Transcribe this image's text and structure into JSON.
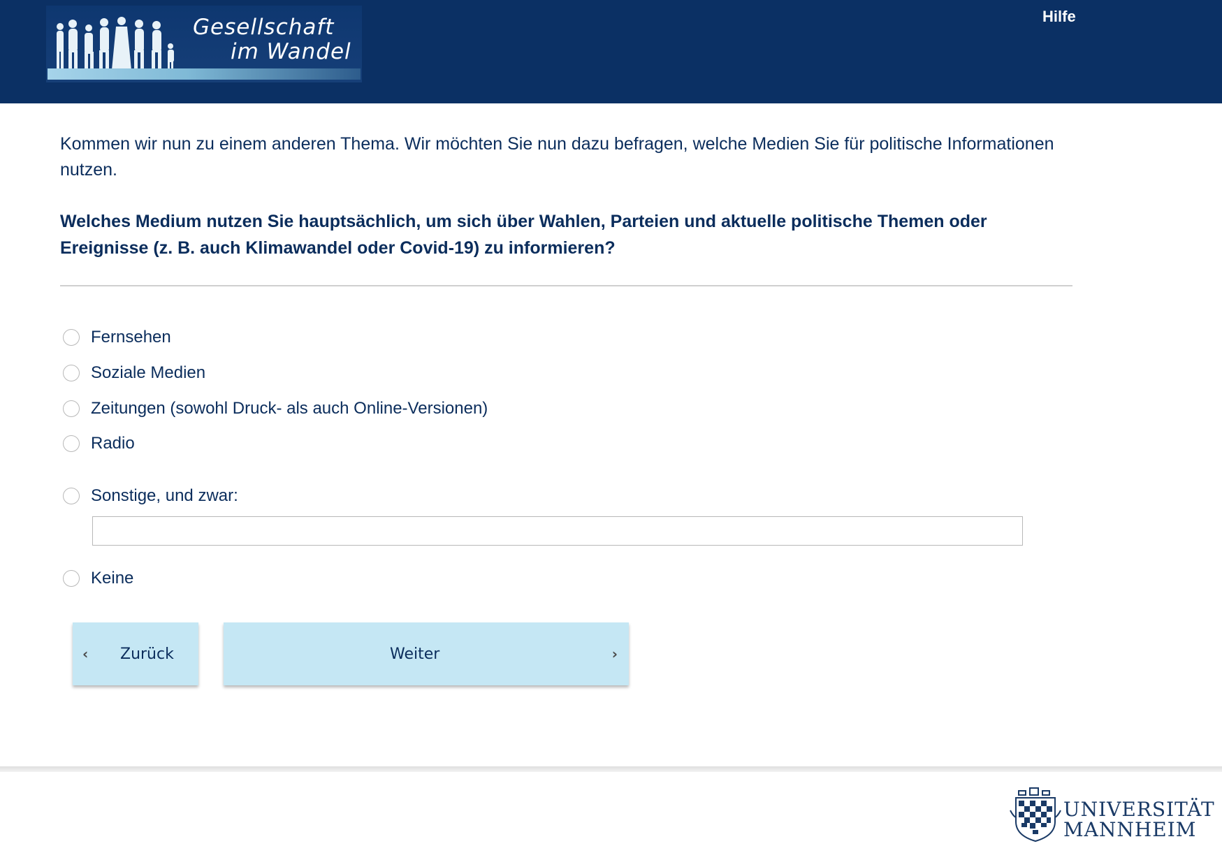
{
  "header": {
    "logo_line1": "Gesellschaft",
    "logo_line2": "im Wandel",
    "help_label": "Hilfe",
    "background_color": "#0b3064"
  },
  "intro_text": "Kommen wir nun zu einem anderen Thema. Wir möchten Sie nun dazu befragen, welche Medien Sie für politische Informationen nutzen.",
  "question_text": "Welches Medium nutzen Sie hauptsächlich, um sich über Wahlen, Parteien und aktuelle politische Themen oder Ereignisse (z. B. auch Klimawandel oder Covid-19) zu informieren?",
  "options": [
    {
      "label": "Fernsehen",
      "selected": false
    },
    {
      "label": "Soziale Medien",
      "selected": false
    },
    {
      "label": "Zeitungen (sowohl Druck- als auch Online-Versionen)",
      "selected": false
    },
    {
      "label": "Radio",
      "selected": false
    },
    {
      "label": "Sonstige, und zwar:",
      "selected": false
    },
    {
      "label": "Keine",
      "selected": false
    }
  ],
  "other_input": {
    "value": "",
    "placeholder": ""
  },
  "buttons": {
    "back_label": "Zurück",
    "next_label": "Weiter",
    "background_color": "#c5e7f4"
  },
  "footer": {
    "university_line1": "UNIVERSITÄT",
    "university_line2": "MANNHEIM"
  },
  "icons": {
    "back": "chevron-left-icon",
    "next": "chevron-right-icon"
  }
}
